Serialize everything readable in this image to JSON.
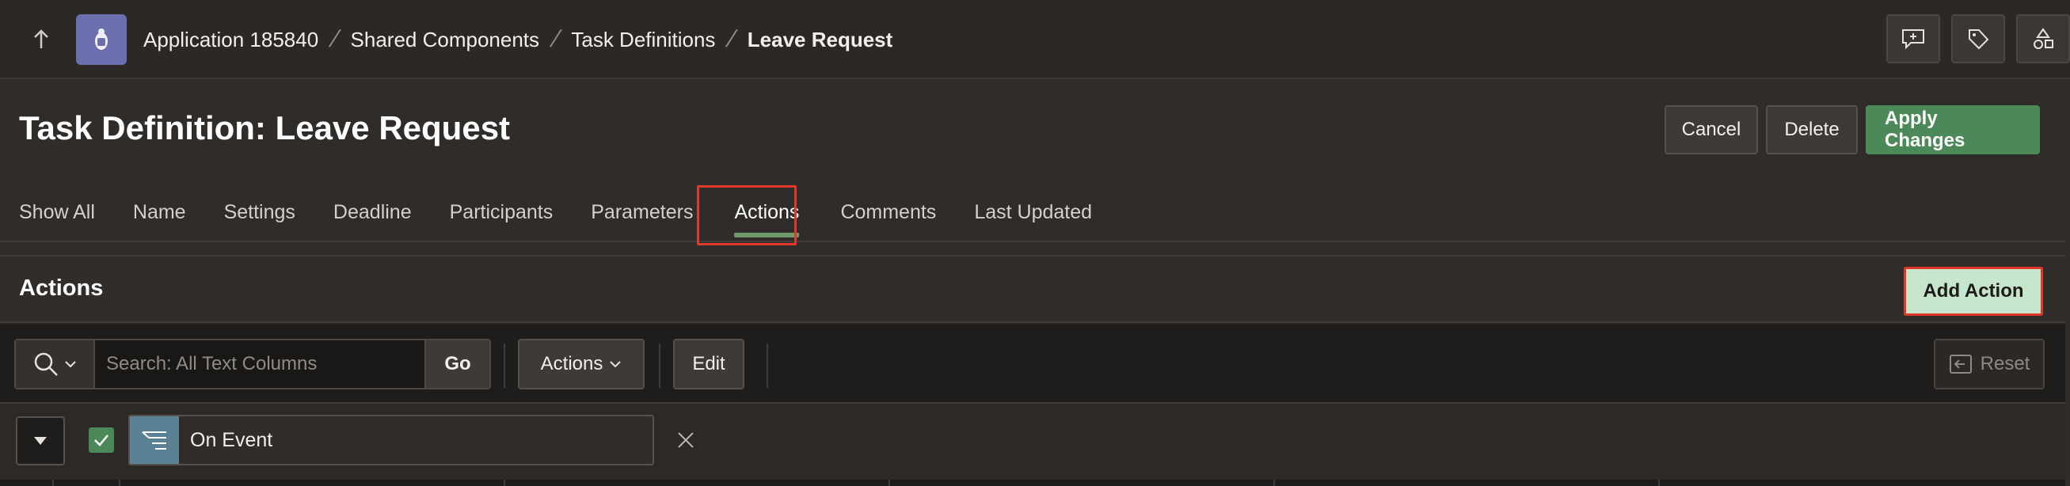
{
  "breadcrumb": {
    "items": [
      "Application 185840",
      "Shared Components",
      "Task Definitions",
      "Leave Request"
    ]
  },
  "page": {
    "title": "Task Definition: Leave Request",
    "buttons": {
      "cancel": "Cancel",
      "delete": "Delete",
      "apply": "Apply Changes"
    }
  },
  "tabs": [
    "Show All",
    "Name",
    "Settings",
    "Deadline",
    "Participants",
    "Parameters",
    "Actions",
    "Comments",
    "Last Updated"
  ],
  "active_tab": "Actions",
  "region": {
    "title": "Actions",
    "add_button": "Add Action",
    "search": {
      "placeholder": "Search: All Text Columns",
      "go": "Go"
    },
    "actions_menu": "Actions",
    "edit": "Edit",
    "reset": "Reset",
    "filter": {
      "label": "On Event"
    }
  },
  "colors": {
    "accent_green": "#4b8a58",
    "add_action_bg": "#c6e6cb",
    "highlight_red": "#e0392b",
    "app_icon": "#6c6fae"
  },
  "icons": {
    "up": "up-arrow-icon",
    "app": "app-icon",
    "feedback": "feedback-plus-icon",
    "markup": "pencil-tag-icon",
    "shared": "shapes-icon",
    "search": "search-icon",
    "chevron": "chevron-down-icon",
    "reset": "reset-icon",
    "filter": "filter-icon",
    "close": "close-icon"
  }
}
